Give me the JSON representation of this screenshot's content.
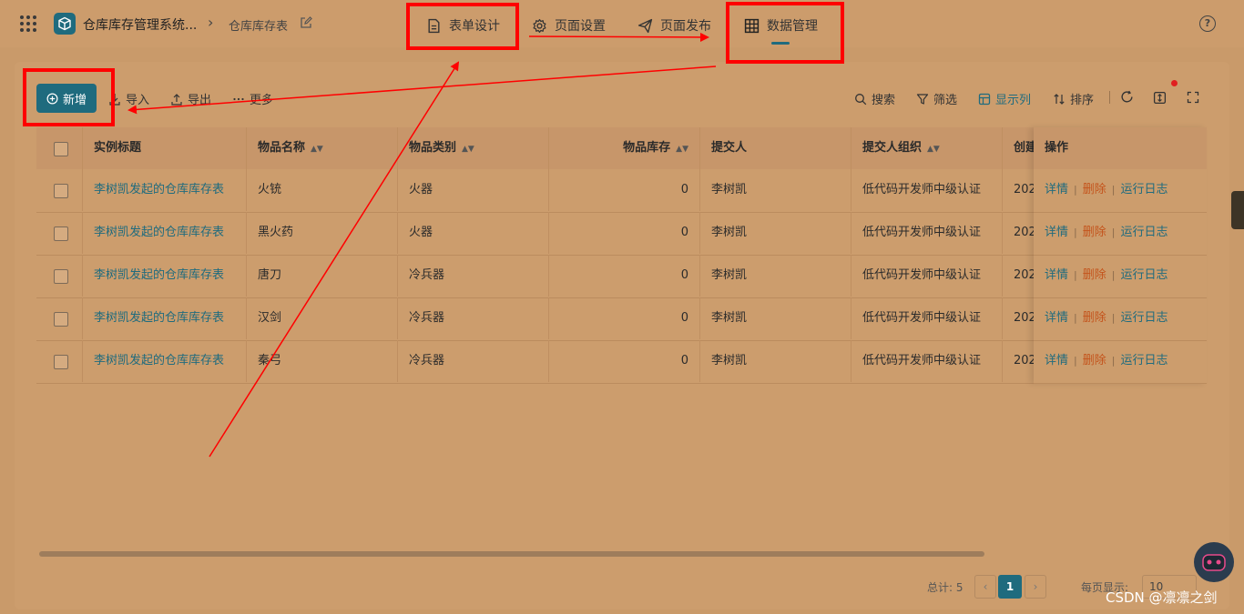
{
  "header": {
    "app_name": "仓库库存管理系统...",
    "crumb_sep": "›",
    "page_name": "仓库库存表",
    "tabs": [
      {
        "label": "表单设计",
        "icon": "document-icon"
      },
      {
        "label": "页面设置",
        "icon": "gear-icon"
      },
      {
        "label": "页面发布",
        "icon": "send-icon"
      },
      {
        "label": "数据管理",
        "icon": "table-icon"
      }
    ],
    "active_tab": "数据管理",
    "help": "?"
  },
  "toolbar": {
    "add_label": "新增",
    "import_label": "导入",
    "export_label": "导出",
    "more_label": "更多",
    "search_label": "搜索",
    "filter_label": "筛选",
    "columns_label": "显示列",
    "sort_label": "排序"
  },
  "table": {
    "columns": [
      "实例标题",
      "物品名称",
      "物品类别",
      "物品库存",
      "提交人",
      "提交人组织",
      "创建",
      "操作"
    ],
    "rows": [
      [
        "李树凯发起的仓库库存表",
        "火铳",
        "火器",
        "0",
        "李树凯",
        "低代码开发师中级认证",
        "202"
      ],
      [
        "李树凯发起的仓库库存表",
        "黑火药",
        "火器",
        "0",
        "李树凯",
        "低代码开发师中级认证",
        "202"
      ],
      [
        "李树凯发起的仓库库存表",
        "唐刀",
        "冷兵器",
        "0",
        "李树凯",
        "低代码开发师中级认证",
        "202"
      ],
      [
        "李树凯发起的仓库库存表",
        "汉剑",
        "冷兵器",
        "0",
        "李树凯",
        "低代码开发师中级认证",
        "202"
      ],
      [
        "李树凯发起的仓库库存表",
        "秦弓",
        "冷兵器",
        "0",
        "李树凯",
        "低代码开发师中级认证",
        "202"
      ]
    ],
    "actions": [
      "详情",
      "删除",
      "运行日志"
    ]
  },
  "pagination": {
    "total": "总计: 5",
    "prev": "‹",
    "current": "1",
    "next": "›",
    "page_size_label": "每页显示:",
    "page_size": "10"
  },
  "watermark": "CSDN @凛凛之剑",
  "colors": {
    "primary": "#1f6b7e",
    "danger": "#c4541c",
    "annotation_red": "#ff0000",
    "background": "#c99a6a"
  }
}
